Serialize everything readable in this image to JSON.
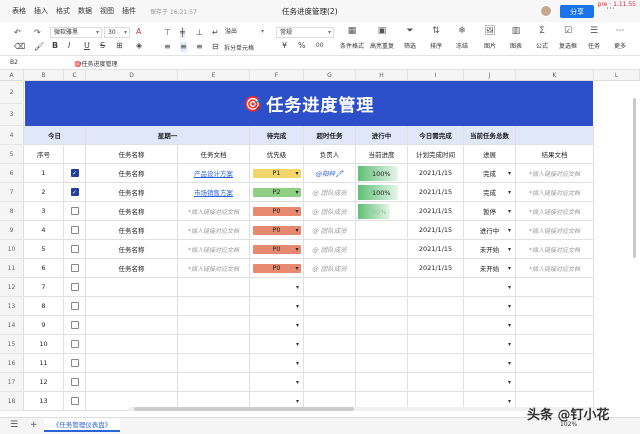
{
  "menu": {
    "items": [
      "表格",
      "插入",
      "格式",
      "数据",
      "视图",
      "插件"
    ],
    "saved": "保存于 16:21:57",
    "doc_title": "任务进度管理(2)",
    "share": "分享",
    "pre": "pre · 1.11.55"
  },
  "toolbar": {
    "font": "微软雅黑",
    "size": "30",
    "overflow": "溢出",
    "number_format": "常规",
    "merge": "拆分单元格",
    "cond": "条件格式",
    "dup": "高亮重复",
    "big": [
      "筛选",
      "排序",
      "冻结",
      "图片",
      "图表",
      "公式",
      "复选框",
      "任务",
      "更多"
    ]
  },
  "formula": {
    "cellref": "B2",
    "content": "🎯任务进度管理"
  },
  "columns": [
    "A",
    "B",
    "C",
    "D",
    "E",
    "F",
    "G",
    "H",
    "I",
    "J",
    "K",
    "L"
  ],
  "banner": {
    "icon": "🎯",
    "title": "任务进度管理"
  },
  "row4": {
    "r": "4",
    "B": "今日",
    "DE": "星期一",
    "F": "待完成",
    "G": "超时任务",
    "H": "进行中",
    "I": "今日需完成",
    "J": "当前任务总数"
  },
  "row5": {
    "r": "5",
    "B": "序号",
    "D": "任务名称",
    "E": "任务文档",
    "F": "优先级",
    "G": "负责人",
    "H": "当前进度",
    "I": "计划完成时间",
    "J": "进展",
    "K": "结果文档"
  },
  "tasks": [
    {
      "r": "6",
      "no": "1",
      "checked": true,
      "name": "任务名称",
      "doc": "产品设计方案",
      "doclink": true,
      "pri": "P1",
      "pricolor": "#f2d56b",
      "person": "@阳梓🖋",
      "person_on": true,
      "prog": "100%",
      "progw": 1.0,
      "date": "2021/1/15",
      "status": "完成",
      "result": "*插入链接对应文档"
    },
    {
      "r": "7",
      "no": "2",
      "checked": true,
      "name": "任务名称",
      "doc": "市场销售方案",
      "doclink": true,
      "pri": "P2",
      "pricolor": "#8fcf83",
      "person": "@ 团队成员",
      "person_on": false,
      "prog": "100%",
      "progw": 1.0,
      "date": "2021/1/15",
      "status": "完成",
      "result": "*插入链接对应文档"
    },
    {
      "r": "8",
      "no": "3",
      "checked": false,
      "name": "任务名称",
      "doc": "*插入链接对应文档",
      "doclink": false,
      "pri": "P0",
      "pricolor": "#e7896f",
      "person": "@ 团队成员",
      "person_on": false,
      "prog": "80%",
      "progw": 0.8,
      "date": "2021/1/15",
      "status": "暂停",
      "result": "*插入链接对应文档"
    },
    {
      "r": "9",
      "no": "4",
      "checked": false,
      "name": "任务名称",
      "doc": "*插入链接对应文档",
      "doclink": false,
      "pri": "P0",
      "pricolor": "#e7896f",
      "person": "@ 团队成员",
      "person_on": false,
      "prog": "",
      "progw": 0,
      "date": "2021/1/15",
      "status": "进行中",
      "result": "*插入链接对应文档"
    },
    {
      "r": "10",
      "no": "5",
      "checked": false,
      "name": "任务名称",
      "doc": "*插入链接对应文档",
      "doclink": false,
      "pri": "P0",
      "pricolor": "#e7896f",
      "person": "@ 团队成员",
      "person_on": false,
      "prog": "",
      "progw": 0,
      "date": "2021/1/15",
      "status": "未开始",
      "result": "*插入链接对应文档"
    },
    {
      "r": "11",
      "no": "6",
      "checked": false,
      "name": "任务名称",
      "doc": "*插入链接对应文档",
      "doclink": false,
      "pri": "P0",
      "pricolor": "#e7896f",
      "person": "@ 团队成员",
      "person_on": false,
      "prog": "",
      "progw": 0,
      "date": "2021/1/15",
      "status": "未开始",
      "result": "*插入链接对应文档"
    }
  ],
  "empty_rows": [
    {
      "r": "12",
      "no": "7"
    },
    {
      "r": "13",
      "no": "8"
    },
    {
      "r": "14",
      "no": "9"
    },
    {
      "r": "15",
      "no": "10"
    },
    {
      "r": "16",
      "no": "11"
    },
    {
      "r": "17",
      "no": "12"
    },
    {
      "r": "18",
      "no": "13"
    }
  ],
  "header_rows": [
    "2",
    "3"
  ],
  "footer": {
    "sheet": "《任务管理仪表盘》",
    "zoom": "102%"
  },
  "watermark": "头条 @钉小花",
  "colors": {
    "banner": "#2d4fc9",
    "header": "#dfe7f8",
    "accent": "#1a73e8"
  }
}
